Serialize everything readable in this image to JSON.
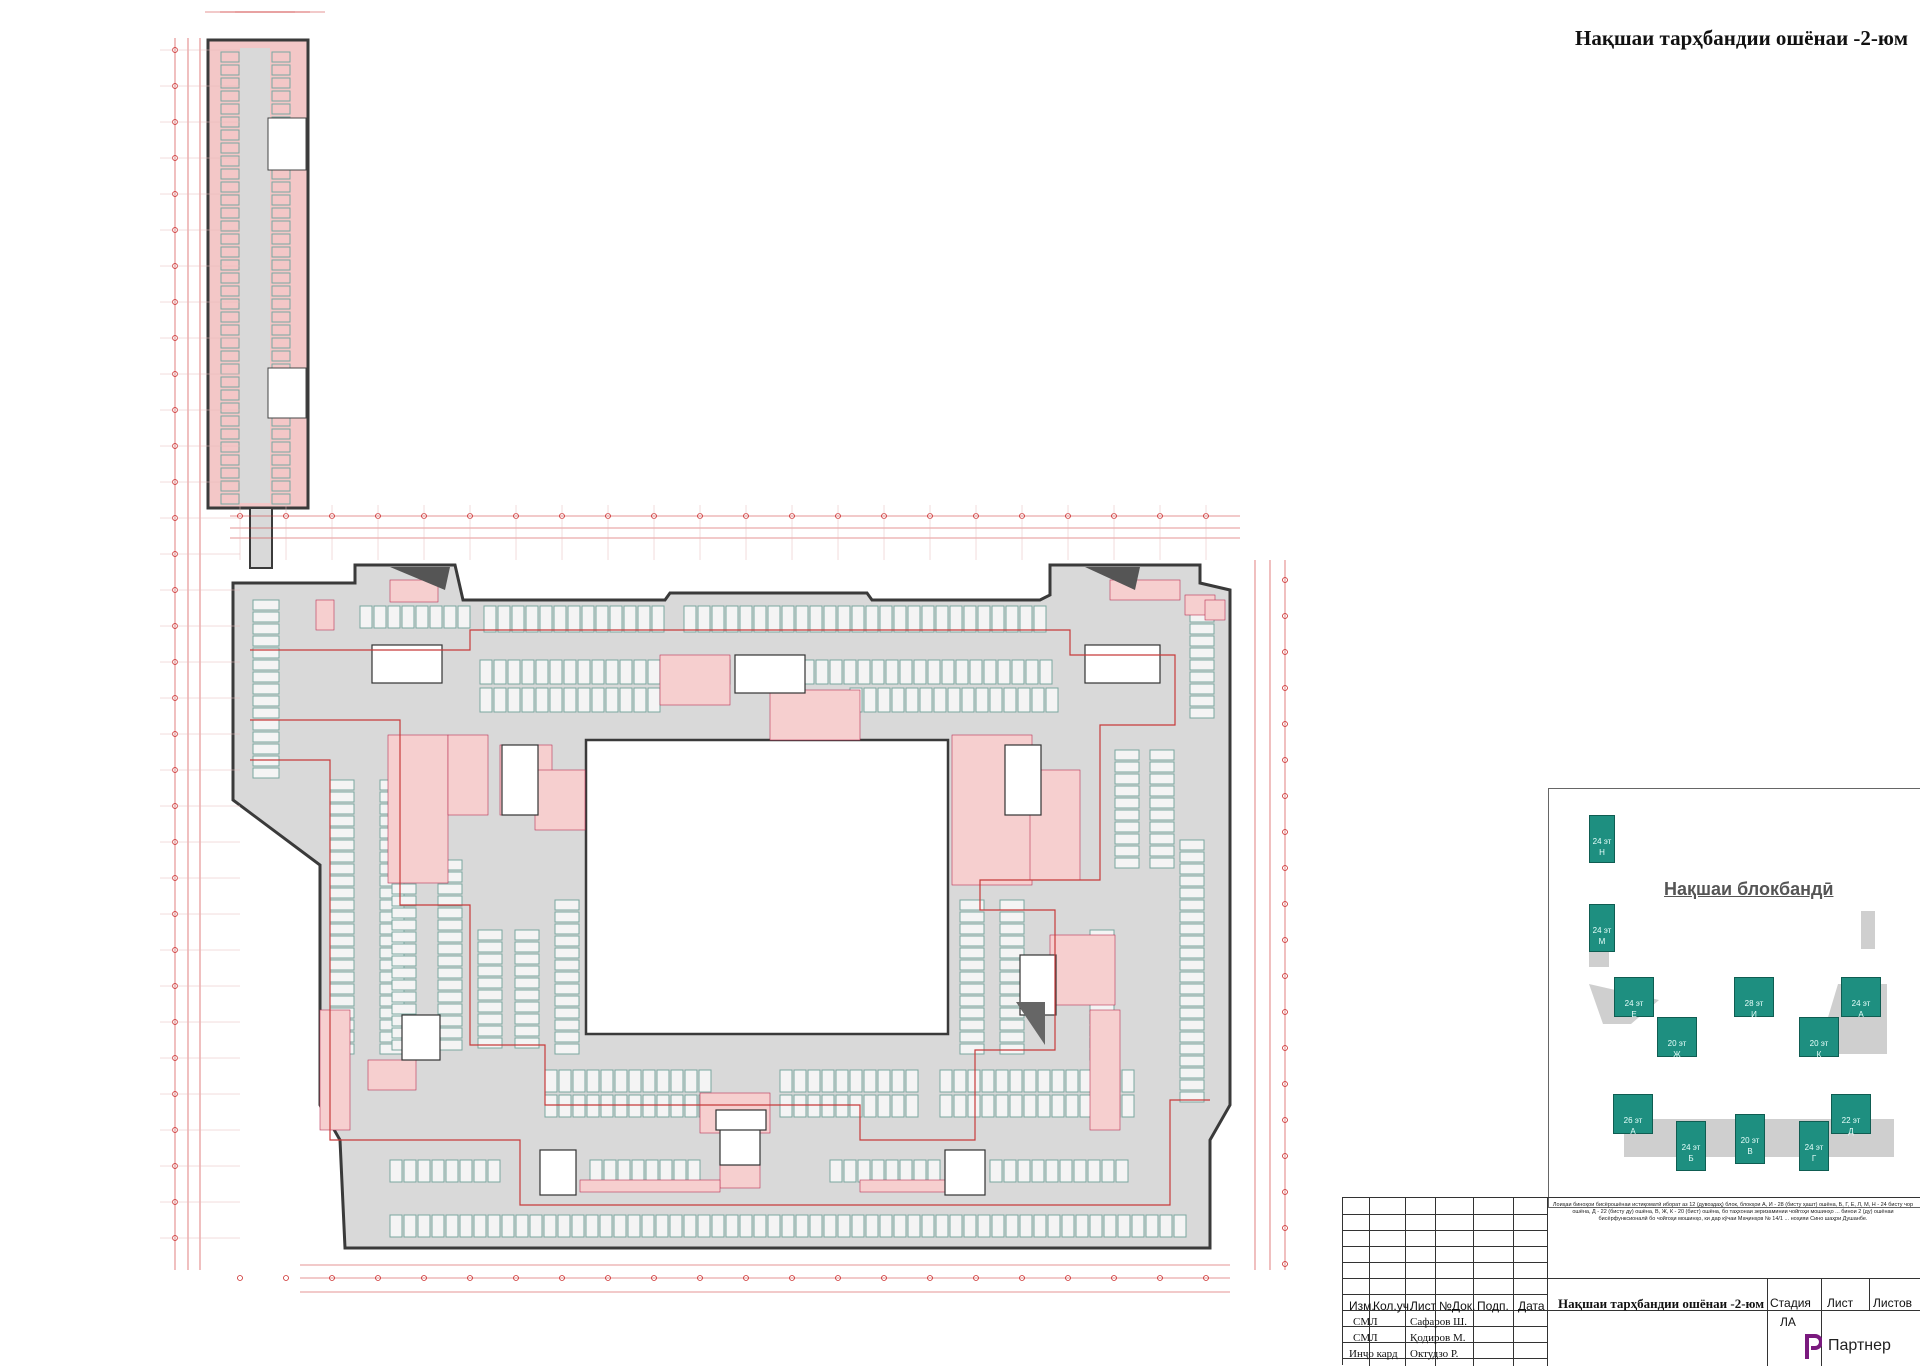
{
  "title": "Нақшаи тарҳбандии ошёнаи -2-юм",
  "plan": {
    "colors": {
      "outline": "#3a3a3a",
      "corridor": "#d9d9d9",
      "service": "#f6cfcf",
      "dimension": "#cc2b2b",
      "parking": "#7aa7a0"
    }
  },
  "keyplan": {
    "title": "Нақшаи блокбандӣ",
    "blocks": [
      {
        "floors": "24 эт",
        "letter": "Н"
      },
      {
        "floors": "24 эт",
        "letter": "М"
      },
      {
        "floors": "24 эт",
        "letter": "Е"
      },
      {
        "floors": "28 эт",
        "letter": "И"
      },
      {
        "floors": "24 эт",
        "letter": "А"
      },
      {
        "floors": "20 эт",
        "letter": "Ж"
      },
      {
        "floors": "20 эт",
        "letter": "К"
      },
      {
        "floors": "26 эт",
        "letter": "А"
      },
      {
        "floors": "22 эт",
        "letter": "Д"
      },
      {
        "floors": "24 эт",
        "letter": "Б"
      },
      {
        "floors": "20 эт",
        "letter": "В"
      },
      {
        "floors": "24 эт",
        "letter": "Г"
      }
    ],
    "block_color": "#1e8f80"
  },
  "title_block": {
    "headers": [
      "Изм.",
      "Кол.уч.",
      "Лист",
      "№Док.",
      "Подп.",
      "Дата"
    ],
    "rows": [
      {
        "role": "СМЛ",
        "name": "Сафаров Ш."
      },
      {
        "role": "СМЛ",
        "name": "Қодиров М."
      },
      {
        "role": "Инҷо кард",
        "name": "Октудзо Р."
      }
    ],
    "note": "Лоиҳаи биноҳои бисёрошёнаи истиқоматӣ иборат аз 12 (дувоздаҳ) блок, блокҳои А, И - 28 (бисту ҳашт) ошёна, Б, Г, Е, Л, М, Н - 24 бисту чор ошёна, Д - 22 (бисту ду) ошёна, В, Ж, К - 20 (бист) ошёна, бо таҳхонаи зеризаминии чойгоҳи мошинҳо ... бинои 2 (ду) ошёнаи бисёрфунксионалӣ бо чойгоҳи мошинҳо, ки дар кӯчаи Маҷинҳов № 14/1 ... ноҳияи Сино шаҳри Душанбе.",
    "sheet_title": "Нақшаи тарҳбандии ошёнаи -2-юм",
    "stage_label": "Стадия",
    "sheet_label": "Лист",
    "sheets_label": "Листов",
    "stage_value": "ЛА",
    "logo_text": "Партнер"
  }
}
